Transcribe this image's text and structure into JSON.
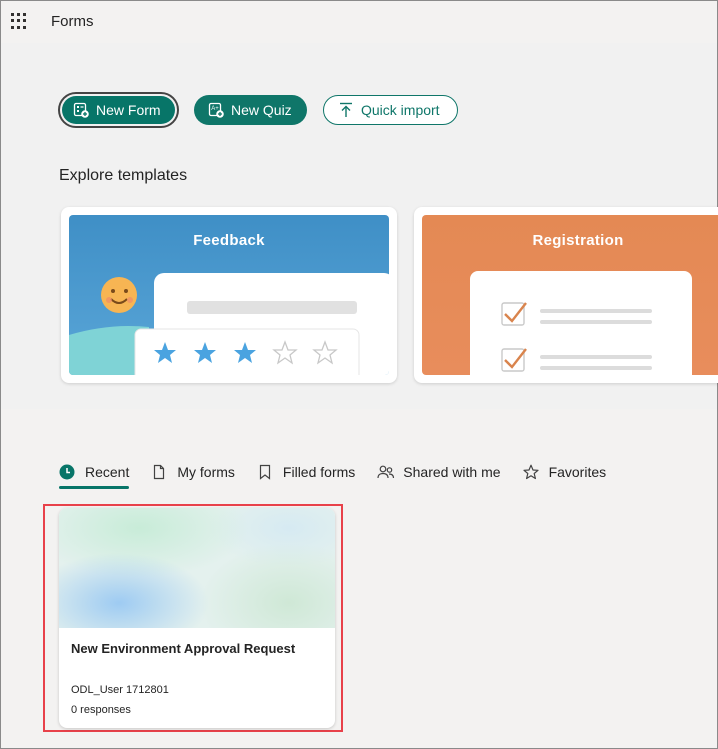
{
  "header": {
    "app_title": "Forms"
  },
  "actions": {
    "new_form": "New Form",
    "new_quiz": "New Quiz",
    "quick_import": "Quick import"
  },
  "templates": {
    "heading": "Explore templates",
    "items": [
      {
        "label": "Feedback"
      },
      {
        "label": "Registration"
      }
    ]
  },
  "tabs": [
    {
      "label": "Recent",
      "icon": "clock-icon",
      "active": true
    },
    {
      "label": "My forms",
      "icon": "document-icon",
      "active": false
    },
    {
      "label": "Filled forms",
      "icon": "bookmark-icon",
      "active": false
    },
    {
      "label": "Shared with me",
      "icon": "people-icon",
      "active": false
    },
    {
      "label": "Favorites",
      "icon": "star-icon",
      "active": false
    }
  ],
  "recent_forms": [
    {
      "title": "New Environment Approval Request",
      "owner": "ODL_User 1712801",
      "responses": "0 responses"
    }
  ],
  "colors": {
    "accent": "#077568",
    "highlight": "#e8414a",
    "feedback": "#3f8fc6",
    "registration": "#e48954"
  }
}
